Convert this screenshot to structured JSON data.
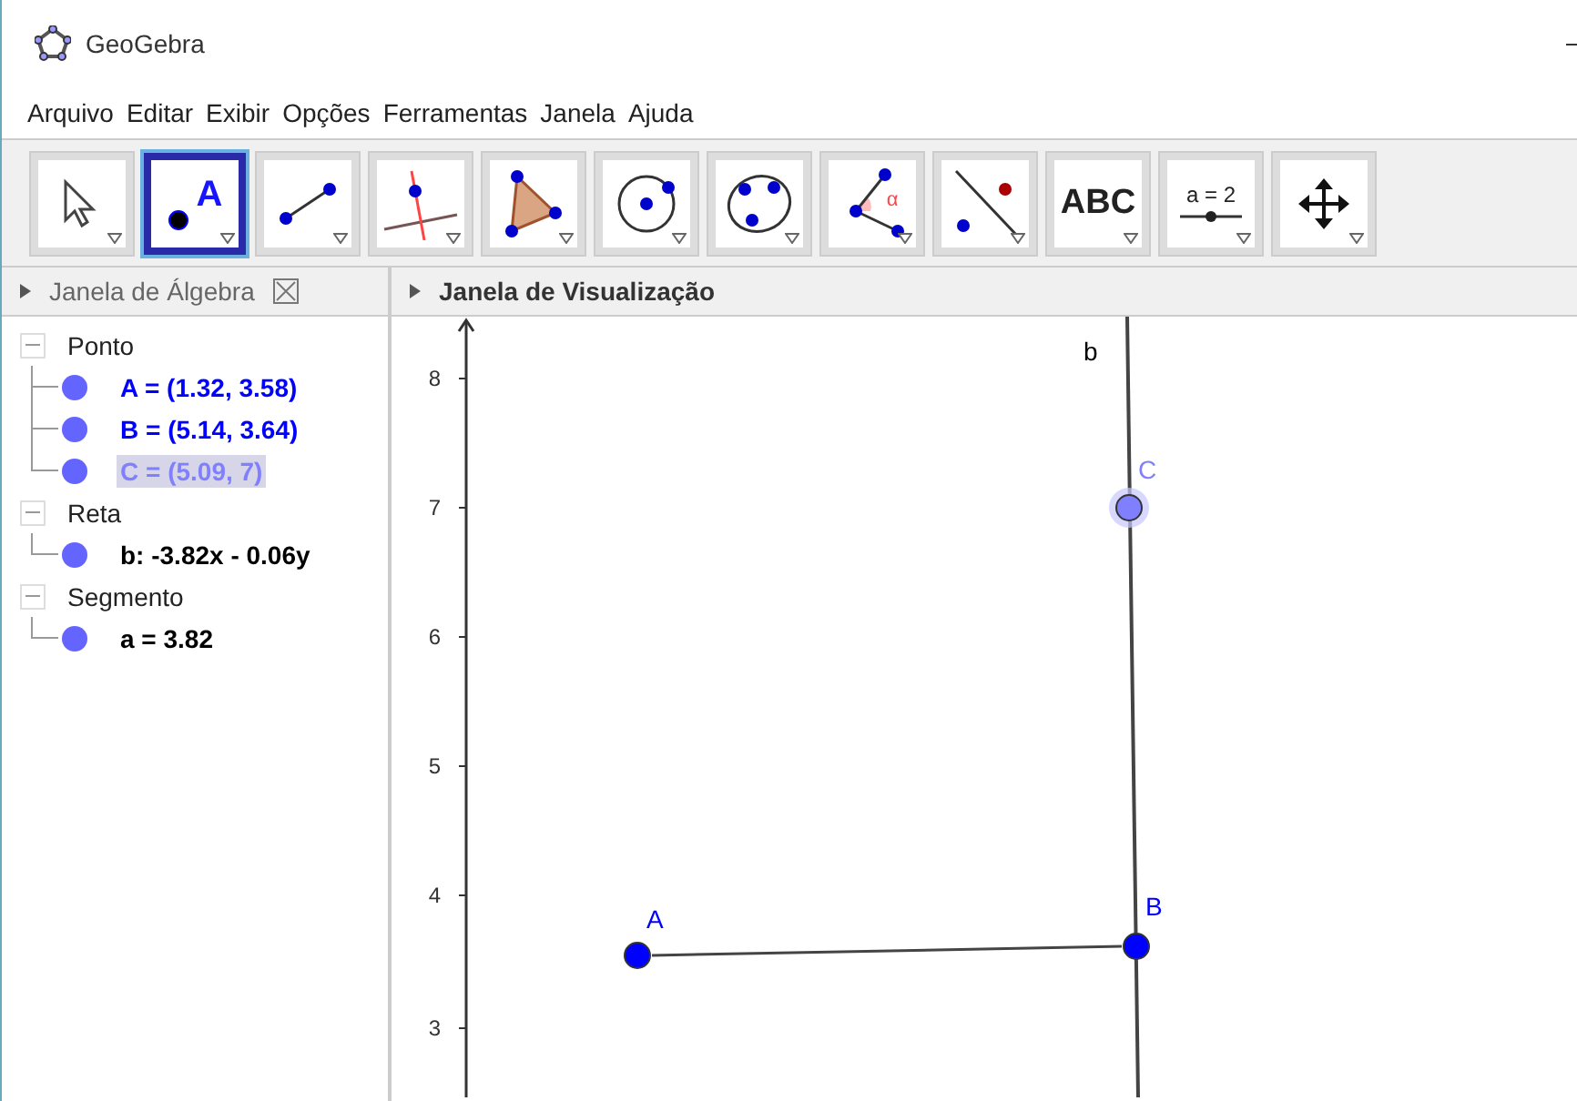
{
  "window": {
    "title": "GeoGebra"
  },
  "menu": [
    "Arquivo",
    "Editar",
    "Exibir",
    "Opções",
    "Ferramentas",
    "Janela",
    "Ajuda"
  ],
  "tools": [
    {
      "kind": "move",
      "selected": false
    },
    {
      "kind": "point",
      "selected": true,
      "label": "A"
    },
    {
      "kind": "segment",
      "selected": false
    },
    {
      "kind": "perpendicular",
      "selected": false
    },
    {
      "kind": "polygon",
      "selected": false
    },
    {
      "kind": "circle",
      "selected": false
    },
    {
      "kind": "conic",
      "selected": false
    },
    {
      "kind": "angle",
      "selected": false,
      "label": "α"
    },
    {
      "kind": "reflect",
      "selected": false
    },
    {
      "kind": "text",
      "selected": false,
      "label": "ABC"
    },
    {
      "kind": "slider",
      "selected": false,
      "label": "a = 2"
    },
    {
      "kind": "pan",
      "selected": false
    }
  ],
  "algebra": {
    "title": "Janela de Álgebra",
    "groups": [
      {
        "label": "Ponto",
        "expanded": true,
        "items": [
          {
            "text": "A = (1.32, 3.58)",
            "color": "#0000ff",
            "selected": false
          },
          {
            "text": "B = (5.14, 3.64)",
            "color": "#0000ff",
            "selected": false
          },
          {
            "text": "C = (5.09, 7)",
            "color": "#8080ff",
            "selected": true
          }
        ]
      },
      {
        "label": "Reta",
        "expanded": true,
        "items": [
          {
            "text": "b: -3.82x - 0.06y",
            "color": "#000000",
            "selected": false
          }
        ]
      },
      {
        "label": "Segmento",
        "expanded": true,
        "items": [
          {
            "text": "a = 3.82",
            "color": "#000000",
            "selected": false
          }
        ]
      }
    ]
  },
  "graphics": {
    "title": "Janela de Visualização",
    "y_ticks": [
      "8",
      "7",
      "6",
      "5",
      "4",
      "3"
    ],
    "objects": [
      {
        "kind": "line",
        "label": "b",
        "selected": false
      },
      {
        "kind": "segment",
        "selected": false
      },
      {
        "kind": "point",
        "label": "A",
        "color": "#0000ff",
        "selected": false
      },
      {
        "kind": "point",
        "label": "B",
        "color": "#0000ff",
        "selected": false
      },
      {
        "kind": "point",
        "label": "C",
        "color": "#8080ff",
        "selected": true
      }
    ]
  }
}
